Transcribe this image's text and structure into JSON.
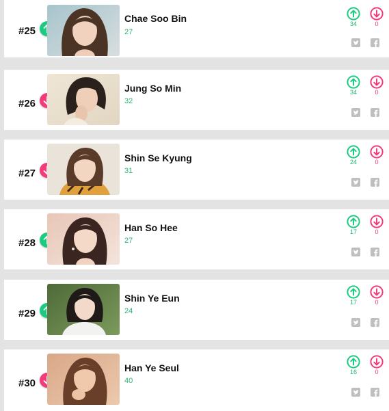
{
  "colors": {
    "up": "#1dcb80",
    "down": "#f13c79",
    "score": "#2bb673",
    "icon_gray": "#bfbfbf"
  },
  "rankings": [
    {
      "rank": "#25",
      "trend": "up",
      "trend_icon": "arrow-up-icon",
      "name": "Chae Soo Bin",
      "score": "27",
      "upvotes": "34",
      "downvotes": "0"
    },
    {
      "rank": "#26",
      "trend": "down",
      "trend_icon": "arrow-down-icon",
      "name": "Jung So Min",
      "score": "32",
      "upvotes": "34",
      "downvotes": "0"
    },
    {
      "rank": "#27",
      "trend": "down",
      "trend_icon": "arrow-down-icon",
      "name": "Shin Se Kyung",
      "score": "31",
      "upvotes": "24",
      "downvotes": "0"
    },
    {
      "rank": "#28",
      "trend": "up",
      "trend_icon": "arrow-up-icon",
      "name": "Han So Hee",
      "score": "27",
      "upvotes": "17",
      "downvotes": "0"
    },
    {
      "rank": "#29",
      "trend": "up",
      "trend_icon": "arrow-up-icon",
      "name": "Shin Ye Eun",
      "score": "24",
      "upvotes": "17",
      "downvotes": "0"
    },
    {
      "rank": "#30",
      "trend": "down",
      "trend_icon": "arrow-down-icon",
      "name": "Han Ye Seul",
      "score": "40",
      "upvotes": "16",
      "downvotes": "0"
    }
  ],
  "icons": {
    "upvote": "upvote-icon",
    "downvote": "downvote-icon",
    "twitter": "twitter-icon",
    "facebook": "facebook-icon"
  }
}
